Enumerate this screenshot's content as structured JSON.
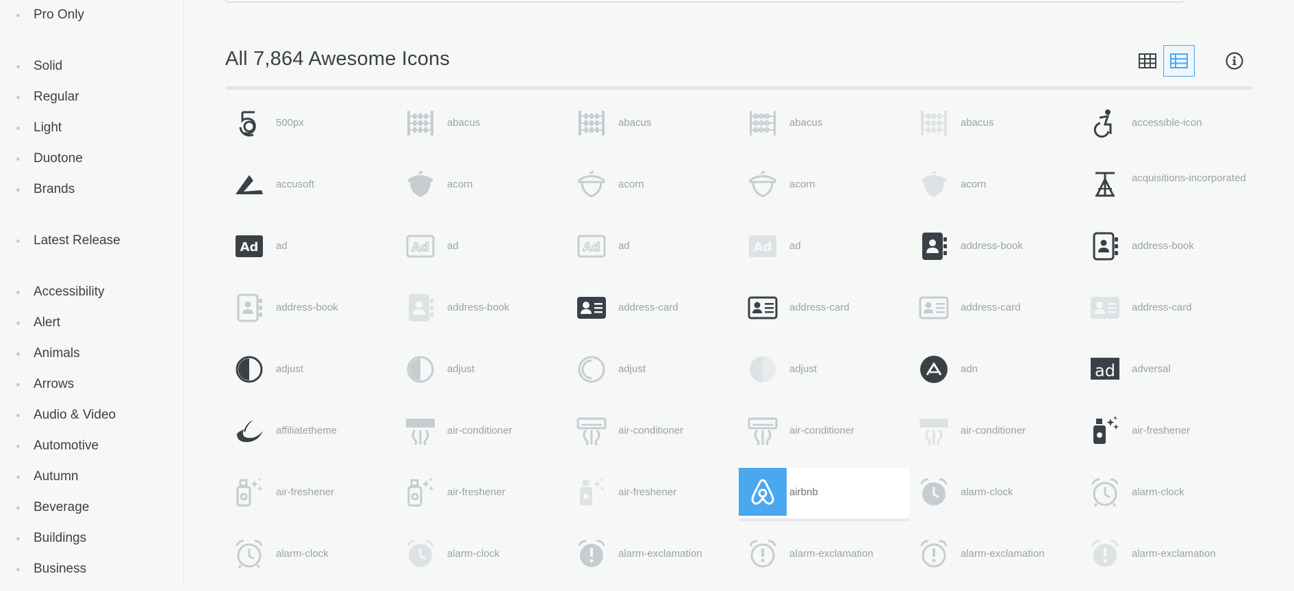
{
  "sidebar": {
    "items": [
      {
        "label": "Pro Only"
      },
      {
        "label": "Solid"
      },
      {
        "label": "Regular"
      },
      {
        "label": "Light"
      },
      {
        "label": "Duotone"
      },
      {
        "label": "Brands"
      },
      {
        "label": "Latest Release"
      },
      {
        "label": "Accessibility"
      },
      {
        "label": "Alert"
      },
      {
        "label": "Animals"
      },
      {
        "label": "Arrows"
      },
      {
        "label": "Audio & Video"
      },
      {
        "label": "Automotive"
      },
      {
        "label": "Autumn"
      },
      {
        "label": "Beverage"
      },
      {
        "label": "Buildings"
      },
      {
        "label": "Business"
      }
    ]
  },
  "header": {
    "title": "All 7,864 Awesome Icons"
  },
  "toolbar": {
    "grid_view": "grid-view-icon",
    "list_view": "list-view-icon",
    "info": "info-circle-icon",
    "active_view": "list"
  },
  "colors": {
    "accent": "#4aa8ef",
    "dark_icon": "#3b4046",
    "light_icon": "#c7ccd1",
    "lighter_icon": "#dfe2e5"
  },
  "icons": [
    {
      "name": "500px",
      "icon": "500px",
      "tone": "dark"
    },
    {
      "name": "abacus",
      "icon": "abacus",
      "tone": "light"
    },
    {
      "name": "abacus",
      "icon": "abacus",
      "tone": "light"
    },
    {
      "name": "abacus",
      "icon": "abacus-outline",
      "tone": "light"
    },
    {
      "name": "abacus",
      "icon": "abacus",
      "tone": "lighter"
    },
    {
      "name": "accessible-icon",
      "icon": "accessible",
      "tone": "dark"
    },
    {
      "name": "accusoft",
      "icon": "accusoft",
      "tone": "dark"
    },
    {
      "name": "acorn",
      "icon": "acorn-solid",
      "tone": "light"
    },
    {
      "name": "acorn",
      "icon": "acorn-outline",
      "tone": "light"
    },
    {
      "name": "acorn",
      "icon": "acorn-outline",
      "tone": "light"
    },
    {
      "name": "acorn",
      "icon": "acorn-solid",
      "tone": "lighter"
    },
    {
      "name": "acquisitions-incorporated",
      "icon": "acquisitions",
      "tone": "dark"
    },
    {
      "name": "ad",
      "icon": "ad-solid",
      "tone": "dark"
    },
    {
      "name": "ad",
      "icon": "ad-outline",
      "tone": "light"
    },
    {
      "name": "ad",
      "icon": "ad-outline",
      "tone": "light"
    },
    {
      "name": "ad",
      "icon": "ad-solid",
      "tone": "lighter"
    },
    {
      "name": "address-book",
      "icon": "book-solid",
      "tone": "dark"
    },
    {
      "name": "address-book",
      "icon": "book-outline",
      "tone": "dark"
    },
    {
      "name": "address-book",
      "icon": "book-outline",
      "tone": "light"
    },
    {
      "name": "address-book",
      "icon": "book-solid",
      "tone": "lighter"
    },
    {
      "name": "address-card",
      "icon": "card-solid",
      "tone": "dark"
    },
    {
      "name": "address-card",
      "icon": "card-outline",
      "tone": "dark"
    },
    {
      "name": "address-card",
      "icon": "card-outline",
      "tone": "light"
    },
    {
      "name": "address-card",
      "icon": "card-solid",
      "tone": "lighter"
    },
    {
      "name": "adjust",
      "icon": "adjust-solid",
      "tone": "dark"
    },
    {
      "name": "adjust",
      "icon": "adjust-solid",
      "tone": "light"
    },
    {
      "name": "adjust",
      "icon": "adjust-outline",
      "tone": "light"
    },
    {
      "name": "adjust",
      "icon": "adjust-half",
      "tone": "lighter"
    },
    {
      "name": "adn",
      "icon": "adn",
      "tone": "dark"
    },
    {
      "name": "adversal",
      "icon": "adversal",
      "tone": "dark"
    },
    {
      "name": "affiliatetheme",
      "icon": "affiliatetheme",
      "tone": "dark"
    },
    {
      "name": "air-conditioner",
      "icon": "ac-solid",
      "tone": "light"
    },
    {
      "name": "air-conditioner",
      "icon": "ac-outline",
      "tone": "light"
    },
    {
      "name": "air-conditioner",
      "icon": "ac-outline",
      "tone": "light"
    },
    {
      "name": "air-conditioner",
      "icon": "ac-solid",
      "tone": "lighter"
    },
    {
      "name": "air-freshener",
      "icon": "freshener",
      "tone": "dark"
    },
    {
      "name": "air-freshener",
      "icon": "freshener-outline",
      "tone": "light"
    },
    {
      "name": "air-freshener",
      "icon": "freshener-outline",
      "tone": "light"
    },
    {
      "name": "air-freshener",
      "icon": "freshener",
      "tone": "lighter"
    },
    {
      "name": "airbnb",
      "icon": "airbnb",
      "tone": "white",
      "highlight": true
    },
    {
      "name": "alarm-clock",
      "icon": "clock-solid",
      "tone": "light"
    },
    {
      "name": "alarm-clock",
      "icon": "clock-outline",
      "tone": "light"
    },
    {
      "name": "alarm-clock",
      "icon": "clock-outline",
      "tone": "light"
    },
    {
      "name": "alarm-clock",
      "icon": "clock-solid",
      "tone": "lighter"
    },
    {
      "name": "alarm-exclamation",
      "icon": "clock-excl-solid",
      "tone": "light"
    },
    {
      "name": "alarm-exclamation",
      "icon": "clock-excl-outline",
      "tone": "light"
    },
    {
      "name": "alarm-exclamation",
      "icon": "clock-excl-outline",
      "tone": "light"
    },
    {
      "name": "alarm-exclamation",
      "icon": "clock-excl-solid",
      "tone": "lighter"
    }
  ]
}
